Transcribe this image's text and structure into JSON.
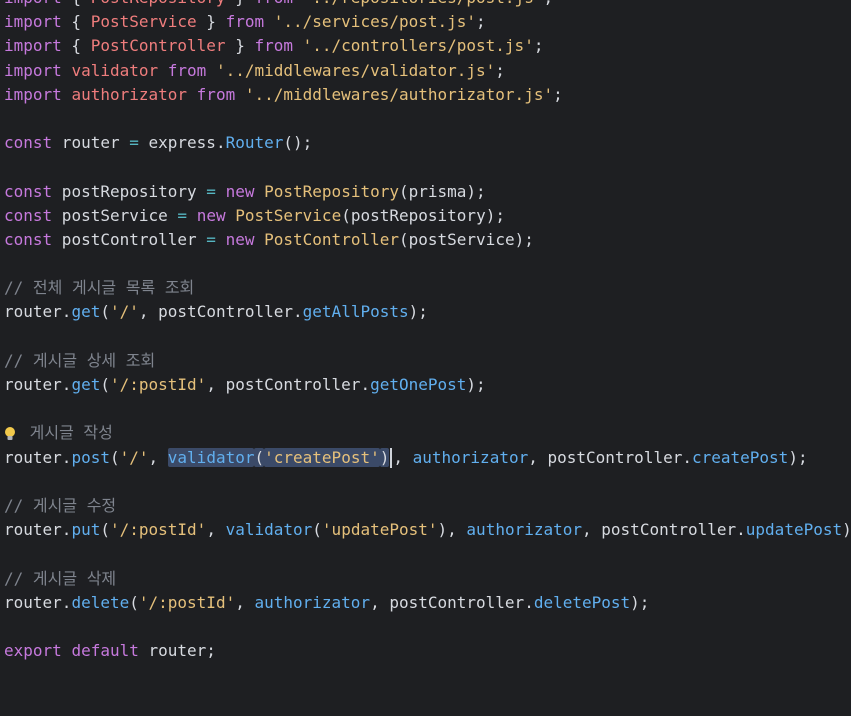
{
  "editor": {
    "lines": [
      {
        "tokens": [
          {
            "t": "import",
            "c": "kw"
          },
          {
            "t": " { ",
            "c": "pl"
          },
          {
            "t": "PostRepository",
            "c": "cls"
          },
          {
            "t": " } ",
            "c": "pl"
          },
          {
            "t": "from",
            "c": "kw"
          },
          {
            "t": " '../repositories/post.js'",
            "c": "str"
          },
          {
            "t": ";",
            "c": "pl"
          }
        ]
      },
      {
        "tokens": [
          {
            "t": "import",
            "c": "kw"
          },
          {
            "t": " { ",
            "c": "pl"
          },
          {
            "t": "PostService",
            "c": "cls"
          },
          {
            "t": " } ",
            "c": "pl"
          },
          {
            "t": "from",
            "c": "kw"
          },
          {
            "t": " '../services/post.js'",
            "c": "str"
          },
          {
            "t": ";",
            "c": "pl"
          }
        ]
      },
      {
        "tokens": [
          {
            "t": "import",
            "c": "kw"
          },
          {
            "t": " { ",
            "c": "pl"
          },
          {
            "t": "PostController",
            "c": "cls"
          },
          {
            "t": " } ",
            "c": "pl"
          },
          {
            "t": "from",
            "c": "kw"
          },
          {
            "t": " '../controllers/post.js'",
            "c": "str"
          },
          {
            "t": ";",
            "c": "pl"
          }
        ]
      },
      {
        "tokens": [
          {
            "t": "import",
            "c": "kw"
          },
          {
            "t": " ",
            "c": "pl"
          },
          {
            "t": "validator",
            "c": "cls"
          },
          {
            "t": " ",
            "c": "pl"
          },
          {
            "t": "from",
            "c": "kw"
          },
          {
            "t": " '../middlewares/validator.js'",
            "c": "str"
          },
          {
            "t": ";",
            "c": "pl"
          }
        ]
      },
      {
        "tokens": [
          {
            "t": "import",
            "c": "kw"
          },
          {
            "t": " ",
            "c": "pl"
          },
          {
            "t": "authorizator",
            "c": "cls"
          },
          {
            "t": " ",
            "c": "pl"
          },
          {
            "t": "from",
            "c": "kw"
          },
          {
            "t": " '../middlewares/authorizator.js'",
            "c": "str"
          },
          {
            "t": ";",
            "c": "pl"
          }
        ]
      },
      {
        "tokens": []
      },
      {
        "tokens": [
          {
            "t": "const",
            "c": "kw"
          },
          {
            "t": " router ",
            "c": "pl"
          },
          {
            "t": "=",
            "c": "op"
          },
          {
            "t": " express.",
            "c": "pl"
          },
          {
            "t": "Router",
            "c": "fn"
          },
          {
            "t": "();",
            "c": "pl"
          }
        ]
      },
      {
        "tokens": []
      },
      {
        "tokens": [
          {
            "t": "const",
            "c": "kw"
          },
          {
            "t": " postRepository ",
            "c": "pl"
          },
          {
            "t": "=",
            "c": "op"
          },
          {
            "t": " ",
            "c": "pl"
          },
          {
            "t": "new",
            "c": "kw"
          },
          {
            "t": " ",
            "c": "pl"
          },
          {
            "t": "PostRepository",
            "c": "str"
          },
          {
            "t": "(prisma);",
            "c": "pl"
          }
        ]
      },
      {
        "tokens": [
          {
            "t": "const",
            "c": "kw"
          },
          {
            "t": " postService ",
            "c": "pl"
          },
          {
            "t": "=",
            "c": "op"
          },
          {
            "t": " ",
            "c": "pl"
          },
          {
            "t": "new",
            "c": "kw"
          },
          {
            "t": " ",
            "c": "pl"
          },
          {
            "t": "PostService",
            "c": "str"
          },
          {
            "t": "(postRepository);",
            "c": "pl"
          }
        ]
      },
      {
        "tokens": [
          {
            "t": "const",
            "c": "kw"
          },
          {
            "t": " postController ",
            "c": "pl"
          },
          {
            "t": "=",
            "c": "op"
          },
          {
            "t": " ",
            "c": "pl"
          },
          {
            "t": "new",
            "c": "kw"
          },
          {
            "t": " ",
            "c": "pl"
          },
          {
            "t": "PostController",
            "c": "str"
          },
          {
            "t": "(postService);",
            "c": "pl"
          }
        ]
      },
      {
        "tokens": []
      },
      {
        "tokens": [
          {
            "t": "// 전체 게시글 목록 조회",
            "c": "cmt"
          }
        ]
      },
      {
        "tokens": [
          {
            "t": "router.",
            "c": "pl"
          },
          {
            "t": "get",
            "c": "fn"
          },
          {
            "t": "(",
            "c": "pl"
          },
          {
            "t": "'/'",
            "c": "str"
          },
          {
            "t": ", postController.",
            "c": "pl"
          },
          {
            "t": "getAllPosts",
            "c": "fn"
          },
          {
            "t": ");",
            "c": "pl"
          }
        ]
      },
      {
        "tokens": []
      },
      {
        "tokens": [
          {
            "t": "// 게시글 상세 조회",
            "c": "cmt"
          }
        ]
      },
      {
        "tokens": [
          {
            "t": "router.",
            "c": "pl"
          },
          {
            "t": "get",
            "c": "fn"
          },
          {
            "t": "(",
            "c": "pl"
          },
          {
            "t": "'/:postId'",
            "c": "str"
          },
          {
            "t": ", postController.",
            "c": "pl"
          },
          {
            "t": "getOnePost",
            "c": "fn"
          },
          {
            "t": ");",
            "c": "pl"
          }
        ]
      },
      {
        "tokens": []
      },
      {
        "bulb": true,
        "tokens": [
          {
            "t": " 게시글 작성",
            "c": "cmt"
          }
        ]
      },
      {
        "tokens": [
          {
            "t": "router.",
            "c": "pl"
          },
          {
            "t": "post",
            "c": "fn"
          },
          {
            "t": "(",
            "c": "pl"
          },
          {
            "t": "'/'",
            "c": "str"
          },
          {
            "t": ", ",
            "c": "pl"
          },
          {
            "t": "validator",
            "c": "fn",
            "sel": true
          },
          {
            "t": "(",
            "c": "pl",
            "sel": true
          },
          {
            "t": "'createPost'",
            "c": "str",
            "sel": true
          },
          {
            "t": ")",
            "c": "pl",
            "sel": true
          },
          {
            "caret": true
          },
          {
            "t": ", ",
            "c": "pl"
          },
          {
            "t": "authorizator",
            "c": "fn"
          },
          {
            "t": ", postController.",
            "c": "pl"
          },
          {
            "t": "createPost",
            "c": "fn"
          },
          {
            "t": ");",
            "c": "pl"
          }
        ]
      },
      {
        "tokens": []
      },
      {
        "tokens": [
          {
            "t": "// 게시글 수정",
            "c": "cmt"
          }
        ]
      },
      {
        "tokens": [
          {
            "t": "router.",
            "c": "pl"
          },
          {
            "t": "put",
            "c": "fn"
          },
          {
            "t": "(",
            "c": "pl"
          },
          {
            "t": "'/:postId'",
            "c": "str"
          },
          {
            "t": ", ",
            "c": "pl"
          },
          {
            "t": "validator",
            "c": "fn"
          },
          {
            "t": "(",
            "c": "pl"
          },
          {
            "t": "'updatePost'",
            "c": "str"
          },
          {
            "t": "), ",
            "c": "pl"
          },
          {
            "t": "authorizator",
            "c": "fn"
          },
          {
            "t": ", postController.",
            "c": "pl"
          },
          {
            "t": "updatePost",
            "c": "fn"
          },
          {
            "t": ");",
            "c": "pl"
          }
        ]
      },
      {
        "tokens": []
      },
      {
        "tokens": [
          {
            "t": "// 게시글 삭제",
            "c": "cmt"
          }
        ]
      },
      {
        "tokens": [
          {
            "t": "router.",
            "c": "pl"
          },
          {
            "t": "delete",
            "c": "fn"
          },
          {
            "t": "(",
            "c": "pl"
          },
          {
            "t": "'/:postId'",
            "c": "str"
          },
          {
            "t": ", ",
            "c": "pl"
          },
          {
            "t": "authorizator",
            "c": "fn"
          },
          {
            "t": ", postController.",
            "c": "pl"
          },
          {
            "t": "deletePost",
            "c": "fn"
          },
          {
            "t": ");",
            "c": "pl"
          }
        ]
      },
      {
        "tokens": []
      },
      {
        "tokens": [
          {
            "t": "export",
            "c": "kw"
          },
          {
            "t": " ",
            "c": "pl"
          },
          {
            "t": "default",
            "c": "kw"
          },
          {
            "t": " router;",
            "c": "pl"
          }
        ]
      }
    ]
  }
}
